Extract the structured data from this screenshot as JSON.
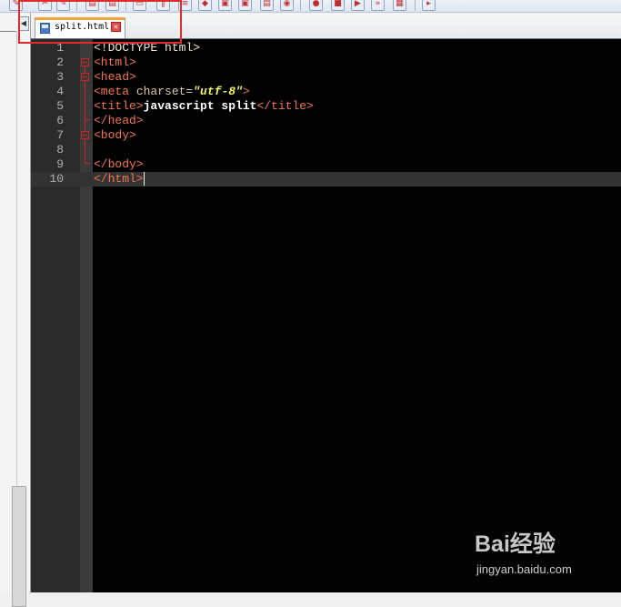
{
  "tab": {
    "title": "split.html",
    "close_glyph": "✕"
  },
  "editor": {
    "lines": [
      {
        "number": "1"
      },
      {
        "number": "2"
      },
      {
        "number": "3"
      },
      {
        "number": "4"
      },
      {
        "number": "5"
      },
      {
        "number": "6"
      },
      {
        "number": "7"
      },
      {
        "number": "8"
      },
      {
        "number": "9"
      },
      {
        "number": "10"
      }
    ],
    "code": {
      "l1": "<!DOCTYPE html>",
      "l2": "<html>",
      "l3": "<head>",
      "l4_open": "<meta",
      "l4_attr": " charset=",
      "l4_val": "\"utf-8\"",
      "l4_close": ">",
      "l5_open": "<title>",
      "l5_text": "javascript split",
      "l5_close": "</title>",
      "l6": "</head>",
      "l7": "<body>",
      "l9": "</body>",
      "l10": "</html>"
    },
    "colors": {
      "tag": "#f4754d",
      "string": "#f2f25a",
      "background": "#000000"
    }
  },
  "watermark": {
    "logo": "Bai经验",
    "url": "jingyan.baidu.com"
  },
  "icons": [
    "panel-collapse-icon",
    "html-file-icon",
    "close-tab-icon",
    "fold-marker-icon"
  ]
}
